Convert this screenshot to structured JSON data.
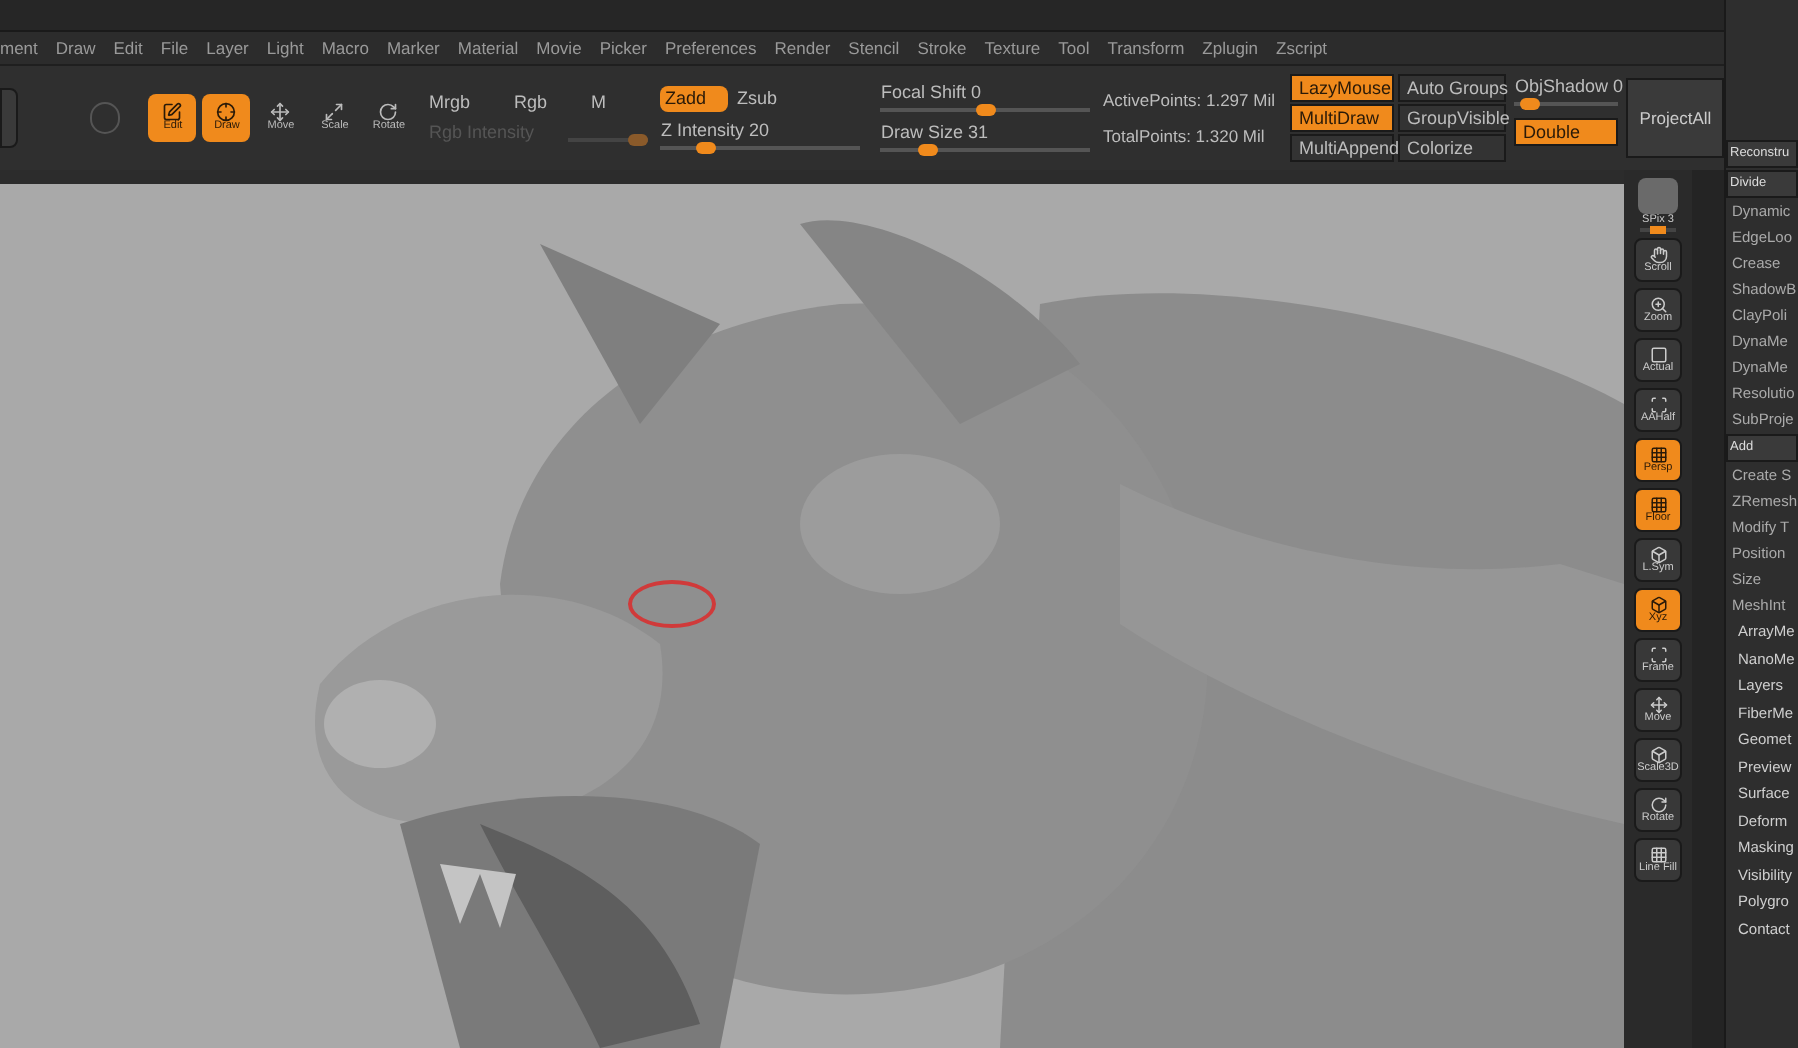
{
  "menu": [
    "ment",
    "Draw",
    "Edit",
    "File",
    "Layer",
    "Light",
    "Macro",
    "Marker",
    "Material",
    "Movie",
    "Picker",
    "Preferences",
    "Render",
    "Stencil",
    "Stroke",
    "Texture",
    "Tool",
    "Transform",
    "Zplugin",
    "Zscript"
  ],
  "toolbar": {
    "tools": [
      {
        "label": "Edit",
        "selected": true
      },
      {
        "label": "Draw",
        "selected": true
      },
      {
        "label": "Move",
        "selected": false
      },
      {
        "label": "Scale",
        "selected": false
      },
      {
        "label": "Rotate",
        "selected": false
      }
    ],
    "color_modes": [
      "Mrgb",
      "Rgb",
      "M"
    ],
    "rgb_intensity": {
      "label": "Rgb Intensity",
      "level": 0.97
    },
    "z_modes": [
      {
        "label": "Zadd",
        "selected": true
      },
      {
        "label": "Zsub",
        "selected": false
      }
    ],
    "z_intensity": {
      "label": "Z Intensity 20",
      "level": 0.2
    },
    "focal_shift": {
      "label": "Focal Shift 0",
      "level": 0.5
    },
    "draw_size": {
      "label": "Draw Size 31",
      "level": 0.2
    },
    "stats": [
      "ActivePoints: 1.297 Mil",
      "TotalPoints: 1.320 Mil"
    ],
    "toggles": [
      {
        "label": "LazyMouse",
        "on": true
      },
      {
        "label": "MultiDraw",
        "on": true
      },
      {
        "label": "MultiAppend",
        "on": false
      }
    ],
    "groups": [
      {
        "label": "Auto Groups",
        "on": false
      },
      {
        "label": "GroupVisible",
        "on": false
      },
      {
        "label": "Colorize",
        "on": false
      }
    ],
    "obj_shadow": {
      "label": "ObjShadow 0",
      "level": 0.05
    },
    "double": {
      "label": "Double",
      "on": true
    },
    "project_all": "ProjectAll"
  },
  "shelf": [
    {
      "kind": "slider",
      "label": "SPix 3",
      "level": 0.5
    },
    {
      "kind": "button",
      "label": "Scroll",
      "on": false
    },
    {
      "kind": "button",
      "label": "Zoom",
      "on": false
    },
    {
      "kind": "button",
      "label": "Actual",
      "on": false
    },
    {
      "kind": "button",
      "label": "AAHalf",
      "on": false
    },
    {
      "kind": "button",
      "label": "Persp",
      "on": true
    },
    {
      "kind": "button",
      "label": "Floor",
      "on": true
    },
    {
      "kind": "button",
      "label": "L.Sym",
      "on": false
    },
    {
      "kind": "button",
      "label": "Xyz",
      "on": true
    },
    {
      "kind": "button",
      "label": "Frame",
      "on": false
    },
    {
      "kind": "button",
      "label": "Move",
      "on": false
    },
    {
      "kind": "button",
      "label": "Scale3D",
      "on": false
    },
    {
      "kind": "button",
      "label": "Rotate",
      "on": false
    },
    {
      "kind": "button",
      "label": "Line Fill",
      "on": false
    }
  ],
  "tool_panel": [
    {
      "kind": "button",
      "label": "Reconstru"
    },
    {
      "kind": "button",
      "label": "Divide"
    },
    {
      "kind": "item",
      "label": "Dynamic"
    },
    {
      "kind": "item",
      "label": "EdgeLoo"
    },
    {
      "kind": "item",
      "label": "Crease"
    },
    {
      "kind": "item",
      "label": "ShadowB"
    },
    {
      "kind": "item",
      "label": "ClayPoli"
    },
    {
      "kind": "item",
      "label": "DynaMe"
    },
    {
      "kind": "item",
      "label": "DynaMe"
    },
    {
      "kind": "item",
      "label": "Resolutio"
    },
    {
      "kind": "item",
      "label": "SubProje"
    },
    {
      "kind": "button",
      "label": "Add"
    },
    {
      "kind": "item",
      "label": "Create S"
    },
    {
      "kind": "item",
      "label": "ZRemesh"
    },
    {
      "kind": "item",
      "label": "Modify T"
    },
    {
      "kind": "item",
      "label": "Position"
    },
    {
      "kind": "item",
      "label": "Size"
    },
    {
      "kind": "item",
      "label": "MeshInt"
    },
    {
      "kind": "section",
      "label": "ArrayMe"
    },
    {
      "kind": "section",
      "label": "NanoMe"
    },
    {
      "kind": "section",
      "label": "Layers"
    },
    {
      "kind": "section",
      "label": "FiberMe"
    },
    {
      "kind": "section",
      "label": "Geomet"
    },
    {
      "kind": "section",
      "label": "Preview"
    },
    {
      "kind": "section",
      "label": "Surface"
    },
    {
      "kind": "section",
      "label": "Deform"
    },
    {
      "kind": "section",
      "label": "Masking"
    },
    {
      "kind": "section",
      "label": "Visibility"
    },
    {
      "kind": "section",
      "label": "Polygro"
    },
    {
      "kind": "section",
      "label": "Contact"
    }
  ]
}
